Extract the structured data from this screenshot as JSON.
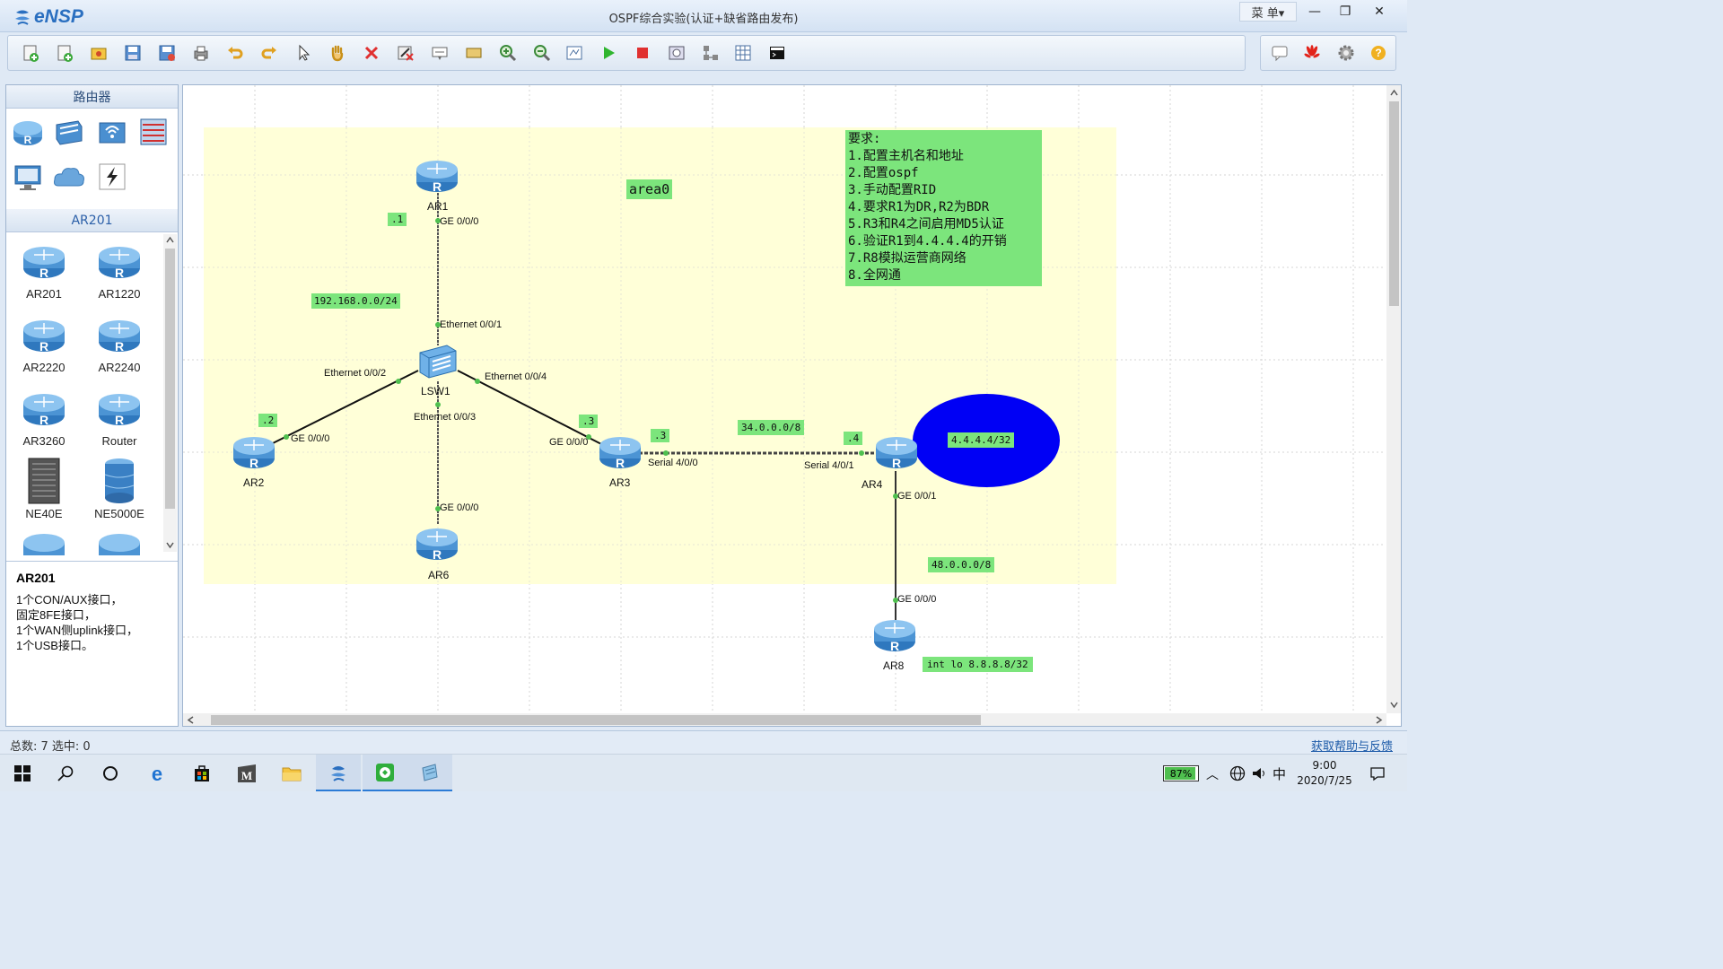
{
  "app": {
    "name": "eNSP",
    "title": "OSPF综合实验(认证+缺省路由发布)",
    "menu_label": "菜 单▾"
  },
  "window_controls": {
    "minimize": "—",
    "restore": "❐",
    "close": "✕"
  },
  "toolbar": {
    "left_icons": [
      "new-topology-icon",
      "new-lab-icon",
      "open-icon",
      "save-icon",
      "save-as-icon",
      "print-icon",
      "undo-icon",
      "redo-icon",
      "select-icon",
      "pan-hand-icon",
      "delete-icon",
      "delete-link-icon",
      "text-icon",
      "rectangle-icon",
      "zoom-in-icon",
      "zoom-out-icon",
      "fit-icon",
      "start-device-icon",
      "stop-device-icon",
      "capture-icon",
      "topology-icon",
      "grid-icon",
      "cli-icon"
    ],
    "right_icons": [
      "chat-icon",
      "huawei-icon",
      "settings-icon",
      "help-icon"
    ]
  },
  "left_panel": {
    "routers_header": "路由器",
    "categories": [
      "router-category-icon",
      "switch-category-icon",
      "wlan-category-icon",
      "firewall-category-icon",
      "pc-category-icon",
      "cloud-category-icon",
      "link-category-icon"
    ],
    "model_header": "AR201",
    "devices": [
      {
        "label": "AR201"
      },
      {
        "label": "AR1220"
      },
      {
        "label": "AR2220"
      },
      {
        "label": "AR2240"
      },
      {
        "label": "AR3260"
      },
      {
        "label": "Router"
      },
      {
        "label": "NE40E"
      },
      {
        "label": "NE5000E"
      }
    ],
    "info": {
      "title": "AR201",
      "lines": [
        "1个CON/AUX接口，",
        "固定8FE接口，",
        "1个WAN侧uplink接口，",
        "1个USB接口。"
      ]
    }
  },
  "topology": {
    "area_label": "area0",
    "requirements": [
      "要求:",
      "1.配置主机名和地址",
      "2.配置ospf",
      "3.手动配置RID",
      "4.要求R1为DR,R2为BDR",
      "5.R3和R4之间启用MD5认证",
      "6.验证R1到4.4.4.4的开销",
      "7.R8模拟运营商网络",
      "8.全网通"
    ],
    "nodes": {
      "ar1": "AR1",
      "ar2": "AR2",
      "ar3": "AR3",
      "ar4": "AR4",
      "ar6": "AR6",
      "ar8": "AR8",
      "lsw1": "LSW1"
    },
    "ports": {
      "ar1_ge": "GE 0/0/0",
      "lsw_e1": "Ethernet 0/0/1",
      "lsw_e2": "Ethernet 0/0/2",
      "lsw_e3": "Ethernet 0/0/3",
      "lsw_e4": "Ethernet 0/0/4",
      "ar2_ge": "GE 0/0/0",
      "ar3_ge": "GE 0/0/0",
      "ar3_serial": "Serial 4/0/0",
      "ar4_serial": "Serial 4/0/1",
      "ar4_ge": "GE 0/0/1",
      "ar6_ge": "GE 0/0/0",
      "ar8_ge": "GE 0/0/0"
    },
    "tags": {
      "ar1_ip": ".1",
      "lan_subnet": "192.168.0.0/24",
      "ar2_ip": ".2",
      "ar3_lan_ip": ".3",
      "ar3_serial_ip": ".3",
      "serial_subnet": "34.0.0.0/8",
      "ar4_ip": ".4",
      "loopback": "4.4.4.4/32",
      "wan_subnet": "48.0.0.0/8",
      "ar8_loopback": "int lo 8.8.8.8/32"
    },
    "colors": {
      "area": "#ffffd8",
      "tag": "#7ce57c",
      "loopback_ellipse": "#0000f5"
    }
  },
  "status": {
    "left": "总数: 7 选中: 0",
    "right": "获取帮助与反馈"
  },
  "taskbar": {
    "apps": [
      "windows-start-icon",
      "search-icon",
      "cortana-icon",
      "edge-icon",
      "store-icon",
      "app-m-icon",
      "file-explorer-icon",
      "ensp-icon",
      "virtualbox-icon",
      "notepad-icon"
    ],
    "battery": "87%",
    "ime": "中",
    "time": "9:00",
    "date": "2020/7/25"
  }
}
